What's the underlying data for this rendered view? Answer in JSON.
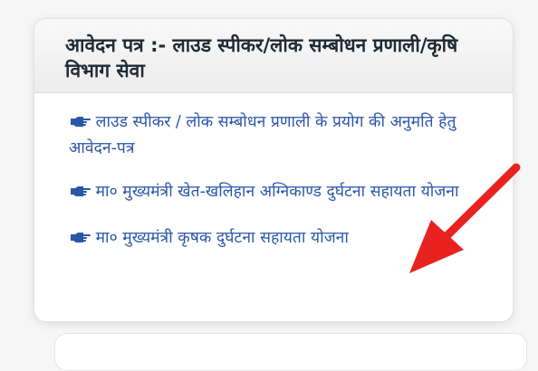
{
  "card": {
    "title": "आवेदन पत्र :-  लाउड स्पीकर/लोक सम्बोधन प्रणाली/कृषि विभाग सेवा",
    "links": [
      {
        "icon": "pointing-hand-icon",
        "label": "लाउड स्पीकर / लोक सम्बोधन प्रणाली के प्रयोग की अनुमति हेतु आवेदन-पत्र"
      },
      {
        "icon": "pointing-hand-icon",
        "label": "मा० मुख्यमंत्री खेत-खलिहान अग्निकाण्ड दुर्घटना सहायता योजना"
      },
      {
        "icon": "pointing-hand-icon",
        "label": "मा० मुख्यमंत्री कृषक दुर्घटना सहायता योजना"
      }
    ]
  },
  "colors": {
    "link": "#2a56a8",
    "title": "#1f2b34",
    "arrow": "#e8231f"
  }
}
